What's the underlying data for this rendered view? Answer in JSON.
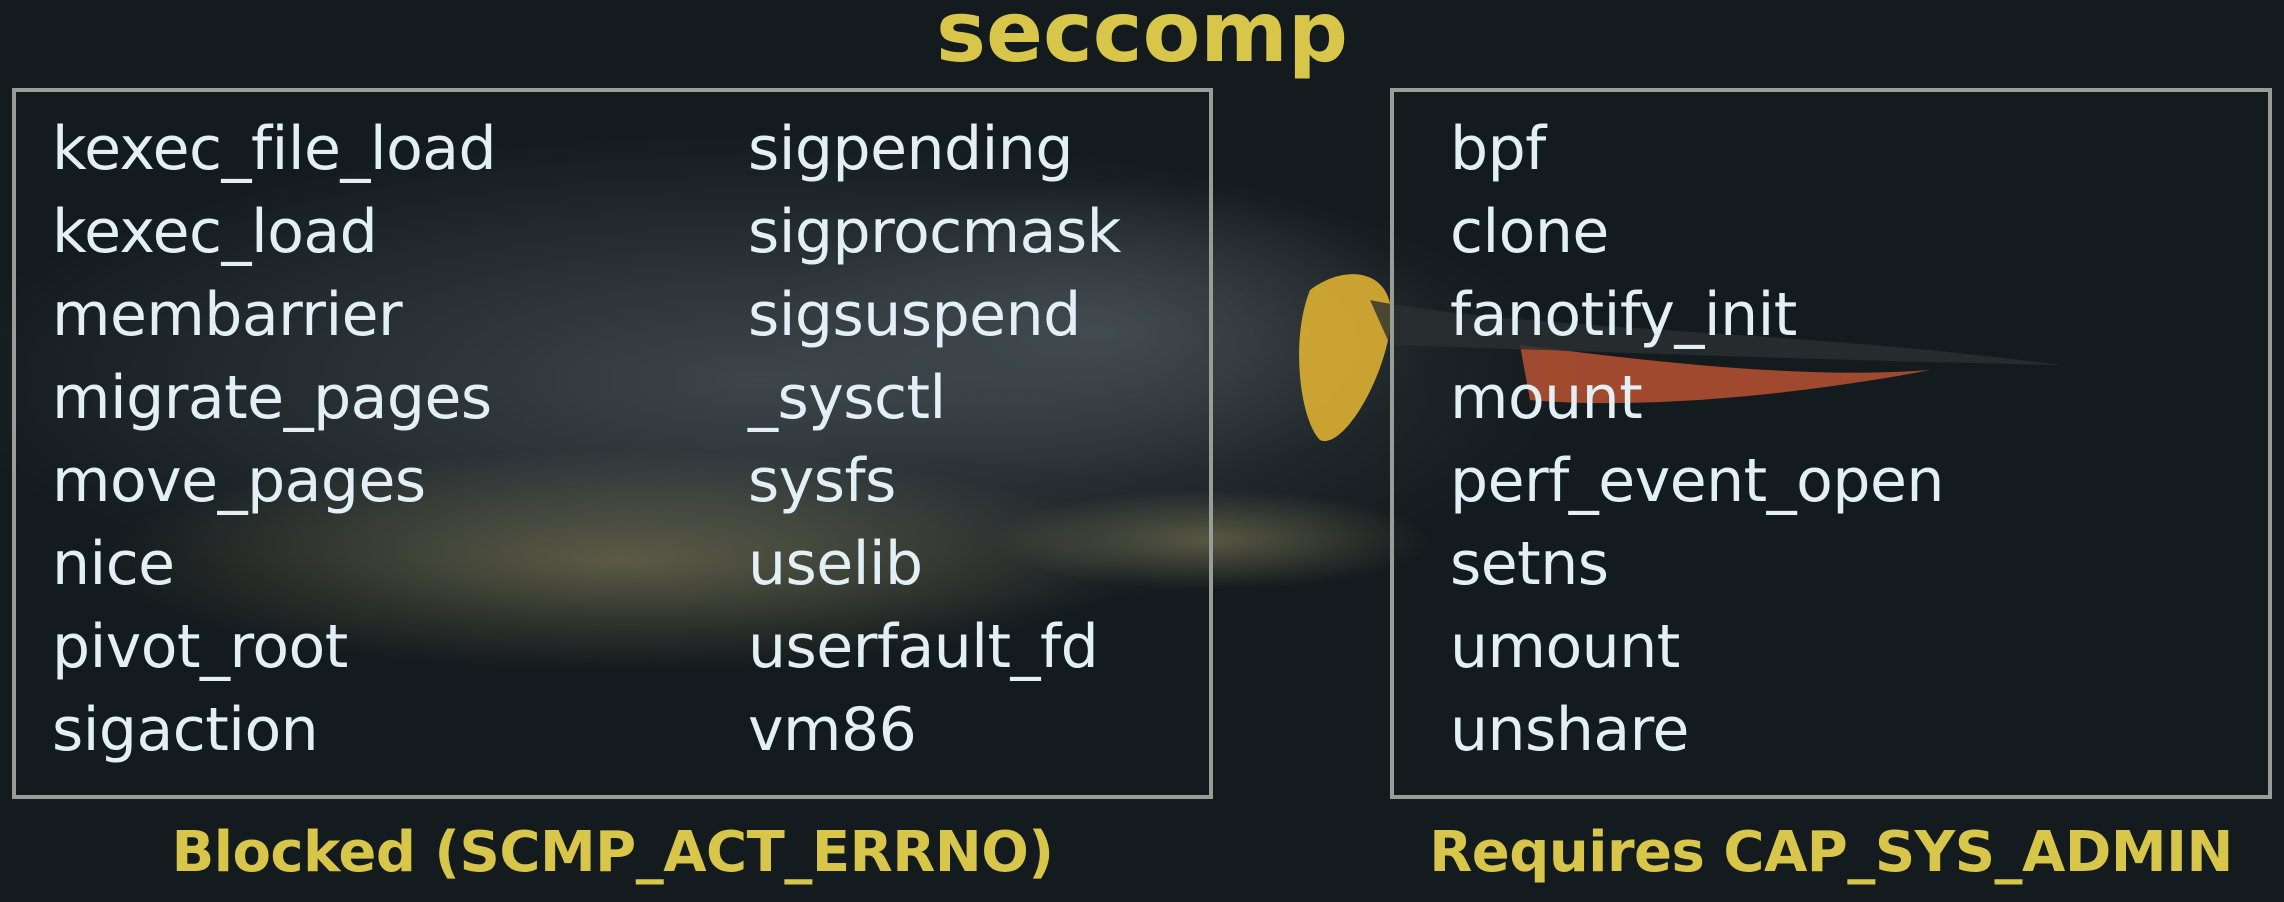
{
  "title": "seccomp",
  "colors": {
    "accent": "#d8c64a",
    "text": "#e2f0f6",
    "border": "#9a9c98",
    "background": "#141b1e"
  },
  "blocked": {
    "column_1": [
      "kexec_file_load",
      "kexec_load",
      "membarrier",
      "migrate_pages",
      "move_pages",
      "nice",
      "pivot_root",
      "sigaction"
    ],
    "column_2": [
      "sigpending",
      "sigprocmask",
      "sigsuspend",
      "_sysctl",
      "sysfs",
      "uselib",
      "userfault_fd",
      "vm86"
    ],
    "caption": "Blocked (SCMP_ACT_ERRNO)"
  },
  "requires_cap": {
    "items": [
      "bpf",
      "clone",
      "fanotify_init",
      "mount",
      "perf_event_open",
      "setns",
      "umount",
      "unshare"
    ],
    "caption": "Requires CAP_SYS_ADMIN"
  }
}
